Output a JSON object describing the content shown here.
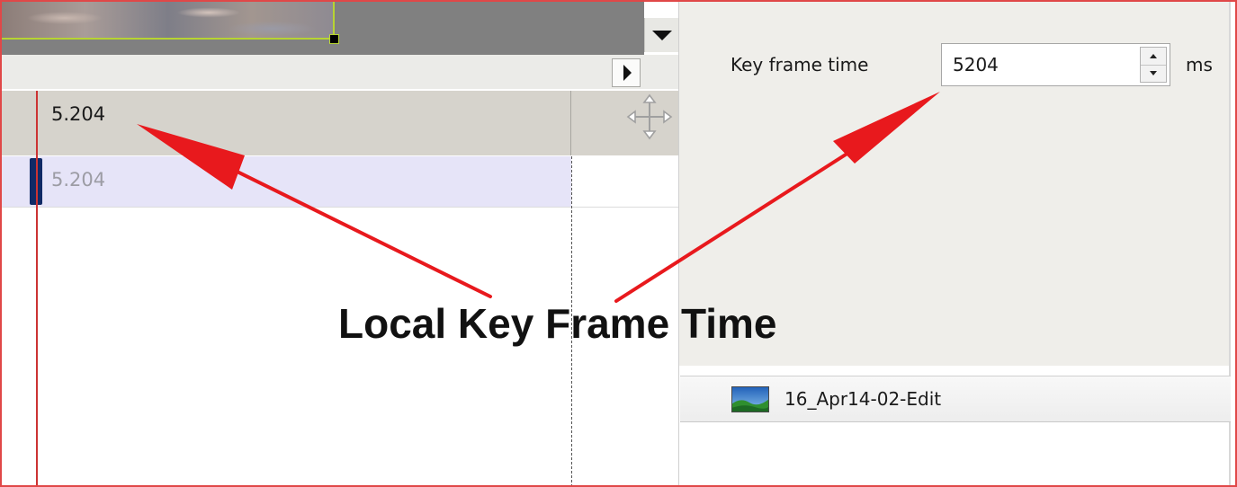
{
  "timeline": {
    "header_value": "5.204",
    "selected_row_value": "5.204"
  },
  "properties": {
    "key_frame_label": "Key frame time",
    "key_frame_value": "5204",
    "unit": "ms"
  },
  "file_list": {
    "items": [
      {
        "name": "16_Apr14-02-Edit",
        "icon": "image-icon"
      }
    ]
  },
  "annotation": {
    "label": "Local Key Frame Time",
    "color": "#e8191d"
  },
  "icons": {
    "dropdown": "chevron-down-icon",
    "scroll_right": "arrow-right-icon",
    "move": "move-icon",
    "spin_up": "spin-up-icon",
    "spin_down": "spin-down-icon"
  }
}
